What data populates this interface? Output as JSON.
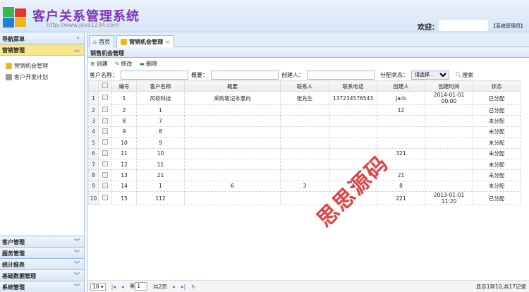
{
  "header": {
    "title": "客户关系管理系统",
    "url": "http://www.java1234.com",
    "welcome": "欢迎：",
    "role": "【系统管理员】"
  },
  "nav": {
    "title": "导航菜单",
    "active": {
      "label": "营销管理",
      "items": [
        "营销机会管理",
        "客户开发计划"
      ]
    },
    "sections": [
      "客户管理",
      "服务管理",
      "统计报表",
      "基础数据管理",
      "系统管理"
    ]
  },
  "tabs": [
    {
      "label": "首页"
    },
    {
      "label": "营销机会管理",
      "close": "×"
    }
  ],
  "panel": {
    "title": "销售机会管理"
  },
  "toolbar": {
    "create": "创建",
    "edit": "修改",
    "delete": "删除"
  },
  "search": {
    "customer_label": "客户名称：",
    "summary_label": "概要：",
    "creator_label": "创建人：",
    "status_label": "分配状态：",
    "status_value": "请选择...",
    "search_button": "搜索"
  },
  "table": {
    "columns": [
      "编号",
      "客户名称",
      "概要",
      "联系人",
      "联系电话",
      "创建人",
      "创建时间",
      "状态"
    ],
    "rows": [
      [
        "1",
        "风软科技",
        "采购笔记本意向",
        "张先生",
        "137234576543",
        "Jack",
        "2014-01-01 00:00",
        "已分配"
      ],
      [
        "2",
        "1",
        "",
        "",
        "",
        "12",
        "",
        "已分配"
      ],
      [
        "8",
        "7",
        "",
        "",
        "",
        "",
        "",
        "未分配"
      ],
      [
        "9",
        "8",
        "",
        "",
        "",
        "",
        "",
        "未分配"
      ],
      [
        "10",
        "9",
        "",
        "",
        "",
        "",
        "",
        "未分配"
      ],
      [
        "11",
        "10",
        "",
        "",
        "",
        "321",
        "",
        "未分配"
      ],
      [
        "12",
        "11",
        "",
        "",
        "",
        "",
        "",
        "未分配"
      ],
      [
        "13",
        "21",
        "",
        "",
        "",
        "21",
        "",
        "未分配"
      ],
      [
        "14",
        "1",
        "6",
        "3",
        "4",
        "8",
        "",
        "未分配"
      ],
      [
        "15",
        "112",
        "",
        "",
        "",
        "221",
        "2013-01-01 11:20",
        "已分配"
      ]
    ]
  },
  "watermark": "思思源码",
  "pager": {
    "page_size": "10",
    "page_prefix": "第",
    "page": "1",
    "total_pages": "共2页",
    "info": "显示1到10,共17记录"
  }
}
